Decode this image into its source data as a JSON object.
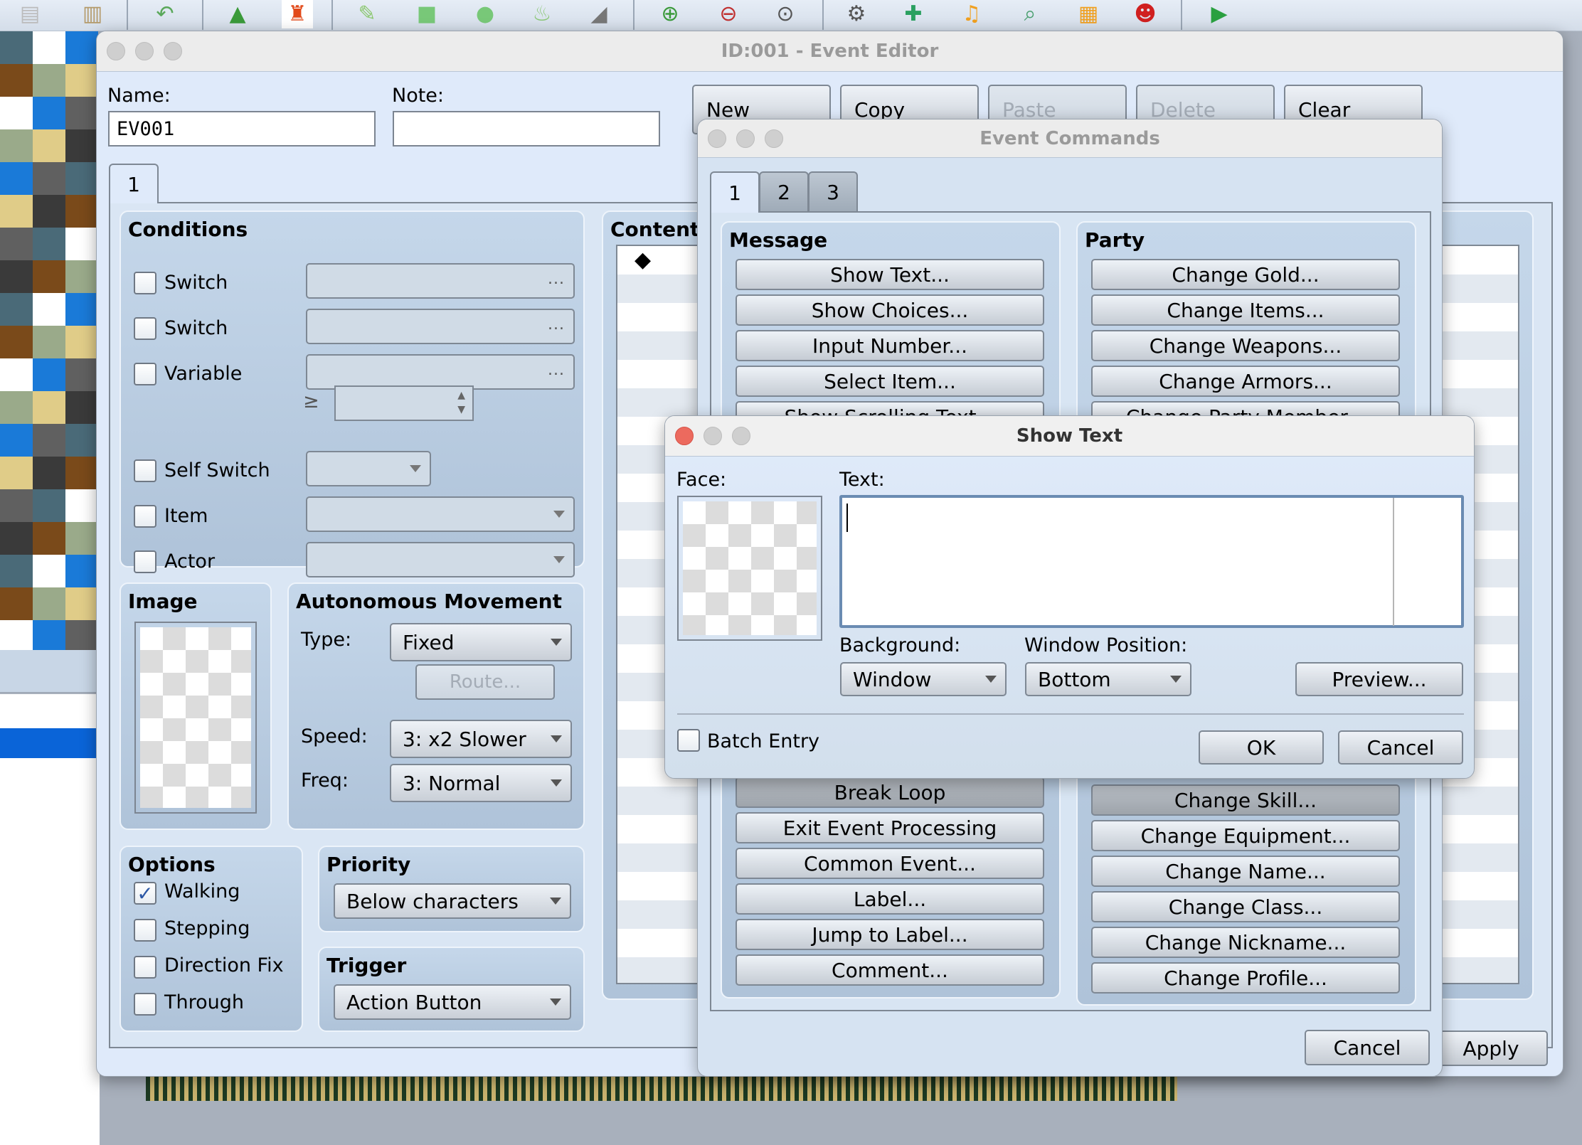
{
  "toolbar": {
    "icons": [
      "copy-icon",
      "paste-icon",
      "undo-icon",
      "map-layer-icon",
      "event-layer-icon",
      "pencil-icon",
      "rectangle-icon",
      "ellipse-icon",
      "fill-icon",
      "shadow-pen-icon",
      "zoom-in-icon",
      "zoom-out-icon",
      "zoom-actual-icon",
      "gear-icon",
      "plugin-icon",
      "sound-icon",
      "search-icon",
      "resource-manager-icon",
      "character-generator-icon",
      "playtest-icon"
    ]
  },
  "event_editor": {
    "title": "ID:001 - Event Editor",
    "name_label": "Name:",
    "name_value": "EV001",
    "note_label": "Note:",
    "note_value": "",
    "buttons": {
      "new": "New",
      "copy": "Copy",
      "paste": "Paste",
      "delete": "Delete",
      "clear": "Clear"
    },
    "page_tab": "1",
    "conditions": {
      "title": "Conditions",
      "rows": [
        {
          "label": "Switch",
          "checked": false
        },
        {
          "label": "Switch",
          "checked": false
        },
        {
          "label": "Variable",
          "checked": false
        },
        {
          "label": "Self Switch",
          "checked": false
        },
        {
          "label": "Item",
          "checked": false
        },
        {
          "label": "Actor",
          "checked": false
        }
      ],
      "compare_symbol": "≥",
      "ellipsis": "..."
    },
    "image": {
      "title": "Image"
    },
    "autonomous_movement": {
      "title": "Autonomous Movement",
      "type_label": "Type:",
      "type_value": "Fixed",
      "route_label": "Route...",
      "speed_label": "Speed:",
      "speed_value": "3: x2 Slower",
      "freq_label": "Freq:",
      "freq_value": "3: Normal"
    },
    "options": {
      "title": "Options",
      "items": [
        {
          "label": "Walking",
          "checked": true,
          "mark": "✓"
        },
        {
          "label": "Stepping",
          "checked": false
        },
        {
          "label": "Direction Fix",
          "checked": false
        },
        {
          "label": "Through",
          "checked": false
        }
      ]
    },
    "priority": {
      "title": "Priority",
      "value": "Below characters"
    },
    "trigger": {
      "title": "Trigger",
      "value": "Action Button"
    },
    "contents": {
      "title": "Contents",
      "first_line_marker": "◆"
    },
    "apply": "Apply"
  },
  "event_commands": {
    "title": "Event Commands",
    "tabs": [
      "1",
      "2",
      "3"
    ],
    "message": {
      "title": "Message",
      "buttons": [
        "Show Text...",
        "Show Choices...",
        "Input Number...",
        "Select Item...",
        "Show Scrolling Text..."
      ]
    },
    "flow_buttons": [
      "Break Loop",
      "Exit Event Processing",
      "Common Event...",
      "Label...",
      "Jump to Label...",
      "Comment..."
    ],
    "party": {
      "title": "Party",
      "buttons": [
        "Change Gold...",
        "Change Items...",
        "Change Weapons...",
        "Change Armors...",
        "Change Party Member..."
      ]
    },
    "actor_buttons": [
      "Change Skill...",
      "Change Equipment...",
      "Change Name...",
      "Change Class...",
      "Change Nickname...",
      "Change Profile..."
    ],
    "cancel": "Cancel"
  },
  "show_text": {
    "title": "Show Text",
    "face_label": "Face:",
    "text_label": "Text:",
    "text_value": "",
    "background_label": "Background:",
    "background_value": "Window",
    "position_label": "Window Position:",
    "position_value": "Bottom",
    "preview": "Preview...",
    "batch_entry": "Batch Entry",
    "batch_checked": false,
    "ok": "OK",
    "cancel": "Cancel"
  }
}
